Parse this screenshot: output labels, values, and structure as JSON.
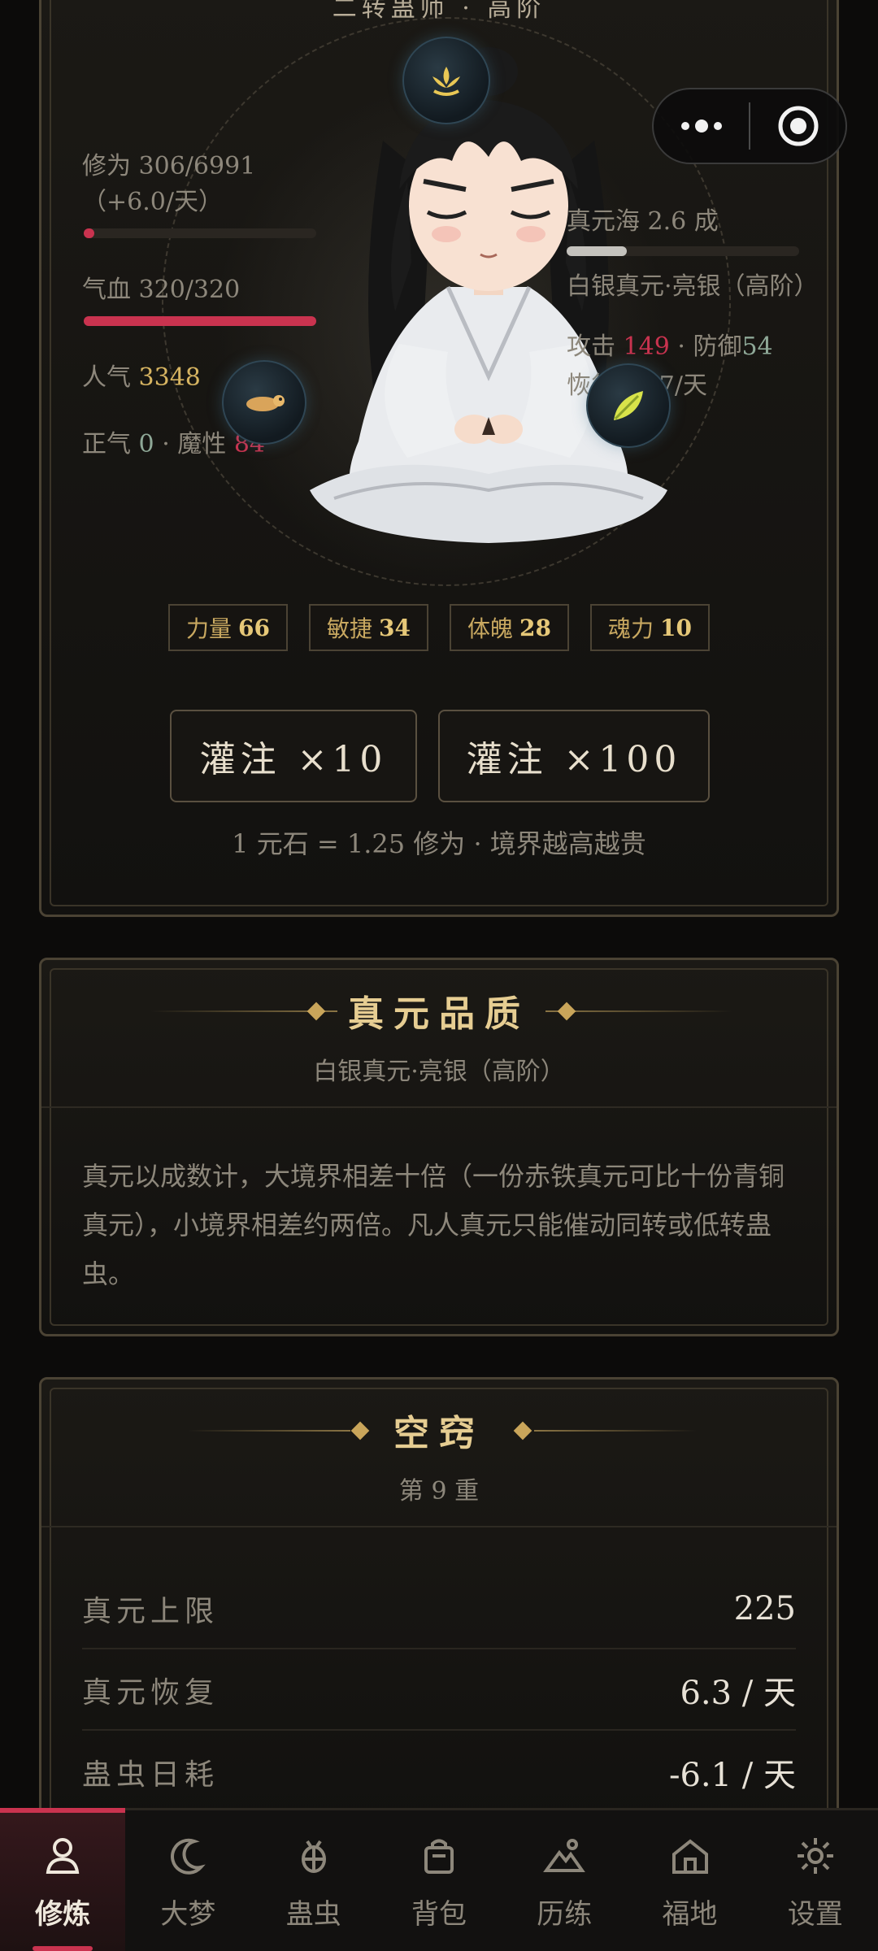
{
  "character_card": {
    "rank_title": "二转蛊师 · 高阶",
    "cultivation": {
      "label": "修为",
      "value": "306/6991",
      "rate": "（+6.0/天）",
      "progress": 0.044
    },
    "blood": {
      "label": "气血",
      "value": "320/320",
      "progress": 1.0
    },
    "popularity": {
      "label": "人气",
      "value": "3348"
    },
    "morality": {
      "righteous_label": "正气",
      "righteous_value": "0",
      "sep": "·",
      "demonic_label": "魔性",
      "demonic_value": "84"
    },
    "essence_sea": {
      "label": "真元海 2.6 成",
      "progress": 0.26
    },
    "essence_grade": "白银真元·亮银（高阶）",
    "combat": {
      "attack_label": "攻击",
      "attack_value": "149",
      "sep": "·",
      "defense_label": "防御",
      "defense_value": "54"
    },
    "recovery": "恢复 +37/天",
    "attributes": [
      {
        "label": "力量",
        "value": "66"
      },
      {
        "label": "敏捷",
        "value": "34"
      },
      {
        "label": "体魄",
        "value": "28"
      },
      {
        "label": "魂力",
        "value": "10"
      }
    ],
    "buttons": {
      "infuse_10": "灌注 ×10",
      "infuse_100": "灌注 ×100"
    },
    "rate_note": "1 元石 = 1.25 修为 · 境界越高越贵"
  },
  "quality_card": {
    "title": "真元品质",
    "subtitle": "白银真元·亮银（高阶）",
    "description": "真元以成数计，大境界相差十倍（一份赤铁真元可比十份青铜真元），小境界相差约两倍。凡人真元只能催动同转或低转蛊虫。"
  },
  "aperture_card": {
    "title": "空窍",
    "subtitle": "第 9 重",
    "rows": [
      {
        "key": "真元上限",
        "value": "225"
      },
      {
        "key": "真元恢复",
        "value": "6.3 / 天"
      },
      {
        "key": "蛊虫日耗",
        "value": "-6.1 / 天"
      }
    ]
  },
  "nav": {
    "items": [
      {
        "label": "修炼",
        "icon": "person-icon"
      },
      {
        "label": "大梦",
        "icon": "moon-icon"
      },
      {
        "label": "蛊虫",
        "icon": "bug-icon"
      },
      {
        "label": "背包",
        "icon": "bag-icon"
      },
      {
        "label": "历练",
        "icon": "mountain-icon"
      },
      {
        "label": "福地",
        "icon": "home-icon"
      },
      {
        "label": "设置",
        "icon": "gear-icon"
      }
    ],
    "active": "修炼"
  },
  "colors": {
    "accent_red": "#c9334f",
    "gold": "#d6b461",
    "teal": "#8ea897",
    "bg": "#0c0b0a"
  }
}
